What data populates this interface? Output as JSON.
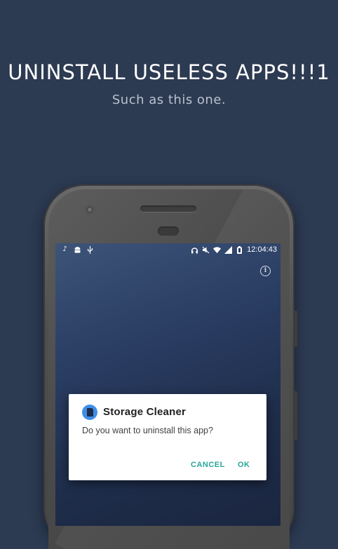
{
  "promo": {
    "headline": "UNINSTALL USELESS APPS!!!1",
    "subline": "Such as this one."
  },
  "statusbar": {
    "left_icons": [
      "music-note-icon",
      "android-icon",
      "usb-icon"
    ],
    "right_icons": [
      "headphones-icon",
      "muted-icon",
      "wifi-icon",
      "signal-icon",
      "battery-icon"
    ],
    "time": "12:04:43"
  },
  "dialog": {
    "app_icon": "sd-card-icon",
    "title": "Storage Cleaner",
    "message": "Do you want to uninstall this app?",
    "cancel_label": "CANCEL",
    "ok_label": "OK"
  },
  "colors": {
    "background": "#2c3a52",
    "accent": "#26a69a",
    "app_icon_bg": "#3f8fe8"
  }
}
